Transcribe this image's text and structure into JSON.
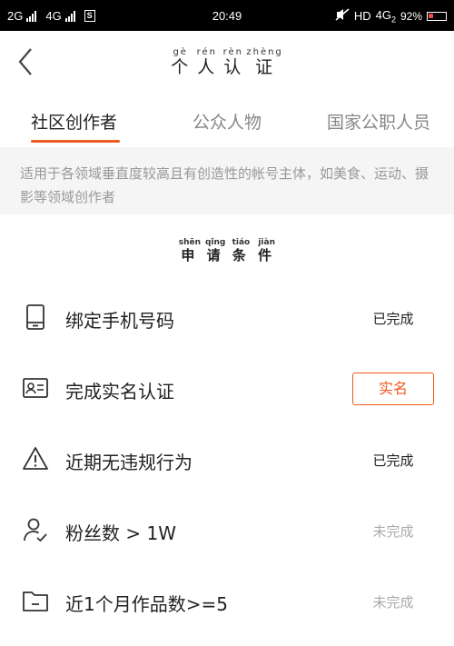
{
  "status_bar": {
    "network_1": "2G",
    "network_2": "4G",
    "sim_glyph": "S",
    "time": "20:49",
    "hd": "HD",
    "network_3": "4G",
    "network_3_sub": "2",
    "battery": "92%"
  },
  "header": {
    "back_icon": "chevron-left-icon",
    "title_chars": [
      "个",
      "人",
      "认",
      "证"
    ],
    "title_pinyin": [
      "gè",
      "rén",
      "rèn",
      "zhèng"
    ]
  },
  "tabs": {
    "items": [
      {
        "label": "社区创作者",
        "active": true
      },
      {
        "label": "公众人物",
        "active": false
      },
      {
        "label": "国家公职人员",
        "active": false
      }
    ],
    "accent_color": "#f05a1e"
  },
  "description": "适用于各领域垂直度较高且有创造性的帐号主体，如美食、运动、摄影等领域创作者",
  "section": {
    "chars": [
      "申",
      "请",
      "条",
      "件"
    ],
    "pinyin": [
      "shēn",
      "qǐng",
      "tiáo",
      "jiàn"
    ]
  },
  "requirements": [
    {
      "icon": "phone-icon",
      "label": "绑定手机号码",
      "status": "已完成",
      "state": "done"
    },
    {
      "icon": "id-card-icon",
      "label": "完成实名认证",
      "status": "实名",
      "state": "action"
    },
    {
      "icon": "warning-icon",
      "label": "近期无违规行为",
      "status": "已完成",
      "state": "done"
    },
    {
      "icon": "user-check-icon",
      "label": "粉丝数 > 1W",
      "status": "未完成",
      "state": "pending"
    },
    {
      "icon": "folder-icon",
      "label": "近1个月作品数>=5",
      "status": "未完成",
      "state": "pending"
    }
  ]
}
